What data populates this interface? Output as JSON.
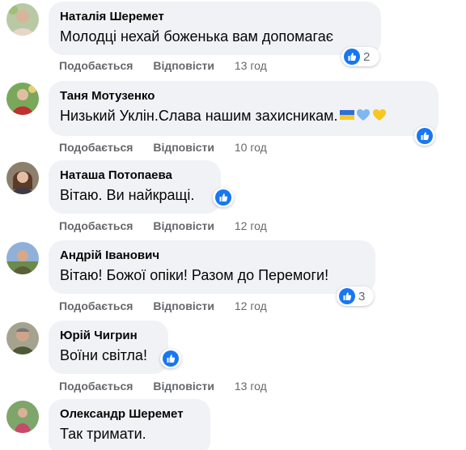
{
  "comments": [
    {
      "author": "Наталія Шеремет",
      "text": "Молодці нехай боженька вам допомагає",
      "reactions_count": "2",
      "like_label": "Подобається",
      "reply_label": "Відповісти",
      "time": "13 год"
    },
    {
      "author": "Таня Мотузенко",
      "text": "Низький Уклін.Слава нашим захисникам.",
      "emoji": [
        "ukraine-flag",
        "blue-heart",
        "yellow-heart"
      ],
      "reactions_count": "",
      "like_label": "Подобається",
      "reply_label": "Відповісти",
      "time": "10 год"
    },
    {
      "author": "Наташа Потопаева",
      "text": "Вітаю. Ви найкращі.",
      "reactions_count": "",
      "like_label": "Подобається",
      "reply_label": "Відповісти",
      "time": "12 год"
    },
    {
      "author": "Андрій Іванович",
      "text": "Вітаю! Божої опіки! Разом до Перемоги!",
      "reactions_count": "3",
      "like_label": "Подобається",
      "reply_label": "Відповісти",
      "time": "12 год"
    },
    {
      "author": "Юрій Чигрин",
      "text": "Воїни світла!",
      "reactions_count": "",
      "like_label": "Подобається",
      "reply_label": "Відповісти",
      "time": "13 год"
    },
    {
      "author": "Олександр Шеремет",
      "text": "Так тримати.",
      "reactions_count": "",
      "like_label": "",
      "reply_label": "",
      "time": ""
    }
  ],
  "colors": {
    "bubble": "#f0f2f5",
    "like_blue": "#1877f2",
    "meta_gray": "#65676b",
    "text": "#050505"
  },
  "icons": {
    "reaction": "like-thumb-icon"
  }
}
